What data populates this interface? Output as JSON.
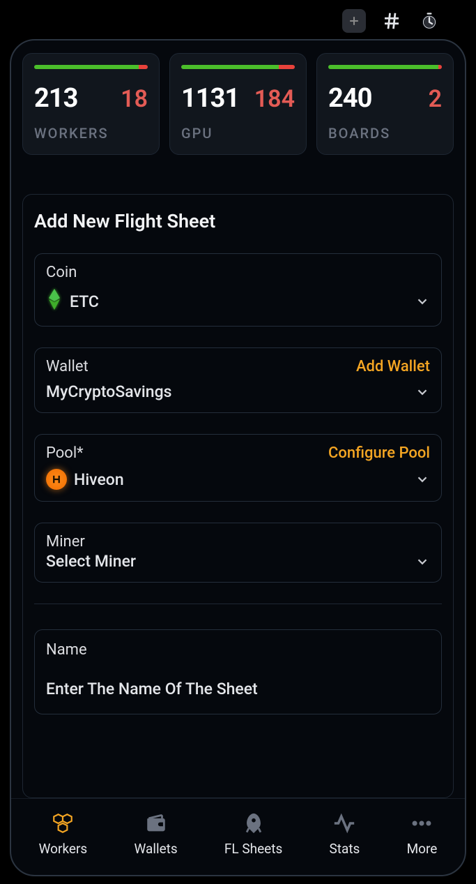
{
  "stats": {
    "workers": {
      "main": "213",
      "alert": "18",
      "label": "WORKERS",
      "green": 92,
      "red": 8
    },
    "gpu": {
      "main": "1131",
      "alert": "184",
      "label": "GPU",
      "green": 86,
      "red": 14
    },
    "boards": {
      "main": "240",
      "alert": "2",
      "label": "BOARDS",
      "green": 97,
      "red": 3
    }
  },
  "form": {
    "title": "Add New Flight Sheet",
    "coin": {
      "label": "Coin",
      "value": "ETC"
    },
    "wallet": {
      "label": "Wallet",
      "action": "Add Wallet",
      "value": "MyCryptoSavings"
    },
    "pool": {
      "label": "Pool*",
      "action": "Configure Pool",
      "value": "Hiveon"
    },
    "miner": {
      "label": "Miner",
      "value": "Select Miner"
    },
    "name": {
      "label": "Name",
      "placeholder": "Enter The Name Of The Sheet"
    }
  },
  "nav": {
    "workers": "Workers",
    "wallets": "Wallets",
    "flsheets": "FL Sheets",
    "stats": "Stats",
    "more": "More"
  }
}
